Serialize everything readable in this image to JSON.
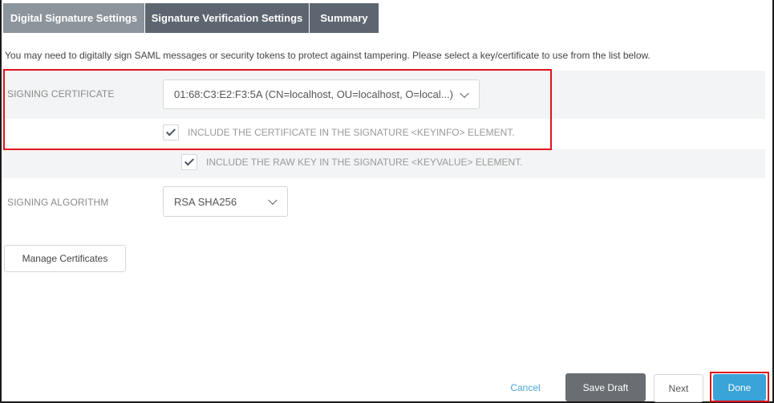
{
  "tabs": [
    {
      "label": "Digital Signature Settings",
      "active": true
    },
    {
      "label": "Signature Verification Settings",
      "active": false
    },
    {
      "label": "Summary",
      "active": false
    }
  ],
  "intro_text": "You may need to digitally sign SAML messages or security tokens to protect against tampering. Please select a key/certificate to use from the list below.",
  "signing_certificate": {
    "label": "SIGNING CERTIFICATE",
    "selected": "01:68:C3:E2:F3:5A (CN=localhost, OU=localhost, O=local...)"
  },
  "checkboxes": [
    {
      "label": "INCLUDE THE CERTIFICATE IN THE SIGNATURE <KEYINFO> ELEMENT.",
      "checked": true
    },
    {
      "label": "INCLUDE THE RAW KEY IN THE SIGNATURE <KEYVALUE> ELEMENT.",
      "checked": true
    }
  ],
  "signing_algorithm": {
    "label": "SIGNING ALGORITHM",
    "selected": "RSA SHA256"
  },
  "manage_button": "Manage Certificates",
  "footer": {
    "cancel": "Cancel",
    "save_draft": "Save Draft",
    "next": "Next",
    "done": "Done"
  },
  "colors": {
    "tab_active": "#8c949c",
    "tab_inactive": "#5d6670",
    "highlight": "#e0141c",
    "primary": "#3aa3d8",
    "link": "#4aa6d6"
  },
  "icons": {
    "dropdown": "chevron-down-icon",
    "check": "checkmark-icon"
  }
}
